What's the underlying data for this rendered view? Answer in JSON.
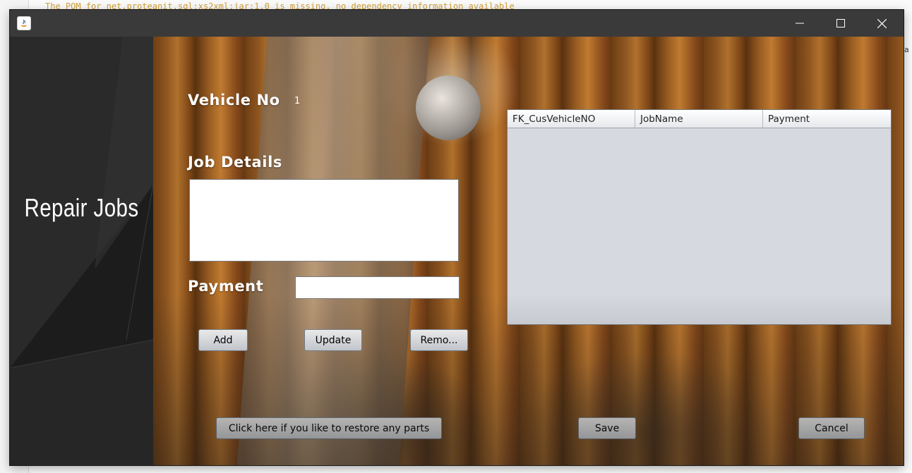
{
  "console": {
    "line": "The POM for net.proteanit.sql:xs2xml:jar:1.0 is missing, no dependency information available",
    "right_char": "a"
  },
  "window": {
    "minimize_icon": "minimize-icon",
    "maximize_icon": "maximize-icon",
    "close_icon": "close-icon"
  },
  "sidebar": {
    "title": "Repair Jobs"
  },
  "form": {
    "vehicle_label": "Vehicle No",
    "vehicle_value": "1",
    "job_details_label": "Job Details",
    "job_details_value": "",
    "payment_label": "Payment",
    "payment_value": ""
  },
  "buttons": {
    "add": "Add",
    "update": "Update",
    "remove": "Remo...",
    "restore": "Click here if you like to restore any parts",
    "save": "Save",
    "cancel": "Cancel"
  },
  "table": {
    "columns": [
      "FK_CusVehicleNO",
      "JobName",
      "Payment"
    ],
    "rows": []
  }
}
